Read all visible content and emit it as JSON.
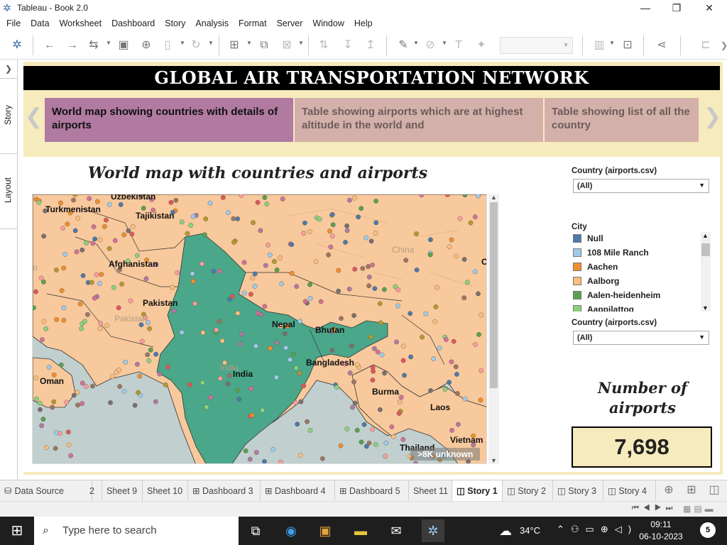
{
  "window": {
    "title": "Tableau - Book 2.0"
  },
  "menu": [
    "File",
    "Data",
    "Worksheet",
    "Dashboard",
    "Story",
    "Analysis",
    "Format",
    "Server",
    "Window",
    "Help"
  ],
  "sidepanel": {
    "story": "Story",
    "layout": "Layout"
  },
  "story": {
    "banner": "GLOBAL AIR TRANSPORTATION NETWORK",
    "points": [
      "World map showing countries with details of airports",
      "Table showing airports which are at highest altitude in the world and",
      "Table showing list of all the country"
    ]
  },
  "dashboard": {
    "title": "World map with countries and airports",
    "map_labels": [
      "Uzbekistan",
      "Turkmenistan",
      "Tajikistan",
      "Afghanistan",
      "Pakistan",
      "Pakistan",
      "China",
      "India",
      "Nepal",
      "Bhutan",
      "Bangladesh",
      "Burma",
      "Laos",
      "Vietnam",
      "Thailand",
      "Oman",
      "India",
      "n",
      "C"
    ],
    "unknown_badge": ">8K unknown",
    "filter1": {
      "title": "Country (airports.csv)",
      "value": "(All)"
    },
    "city_legend": {
      "title": "City",
      "items": [
        {
          "label": "Null",
          "color": "#4e79a7"
        },
        {
          "label": "108 Mile Ranch",
          "color": "#a0cbe8"
        },
        {
          "label": "Aachen",
          "color": "#f28e2b"
        },
        {
          "label": "Aalborg",
          "color": "#ffbe7d"
        },
        {
          "label": "Aalen-heidenheim",
          "color": "#59a14f"
        },
        {
          "label": "Aappilattoq",
          "color": "#8cd17d"
        }
      ]
    },
    "filter2": {
      "title": "Country (airports.csv)",
      "value": "(All)"
    },
    "number_title": "Number of airports",
    "number_value": "7,698"
  },
  "sheet_tabs": [
    "Data Source",
    "2",
    "Sheet 9",
    "Sheet 10",
    "Dashboard 3",
    "Dashboard 4",
    "Dashboard 5",
    "Sheet 11",
    "Story 1",
    "Story 2",
    "Story 3",
    "Story 4"
  ],
  "active_tab": "Story 1",
  "taskbar": {
    "search_placeholder": "Type here to search",
    "weather": "34°C",
    "time": "09:11",
    "date": "06-10-2023",
    "notifications": "5"
  },
  "colors": {
    "banner": "#000000",
    "story_bg": "#f5ebbc",
    "active_point": "#b07aa1",
    "inactive_point": "#d4b0aa",
    "india": "#4aa78a",
    "land": "#f8c99c",
    "sea": "#c1d0cf"
  }
}
